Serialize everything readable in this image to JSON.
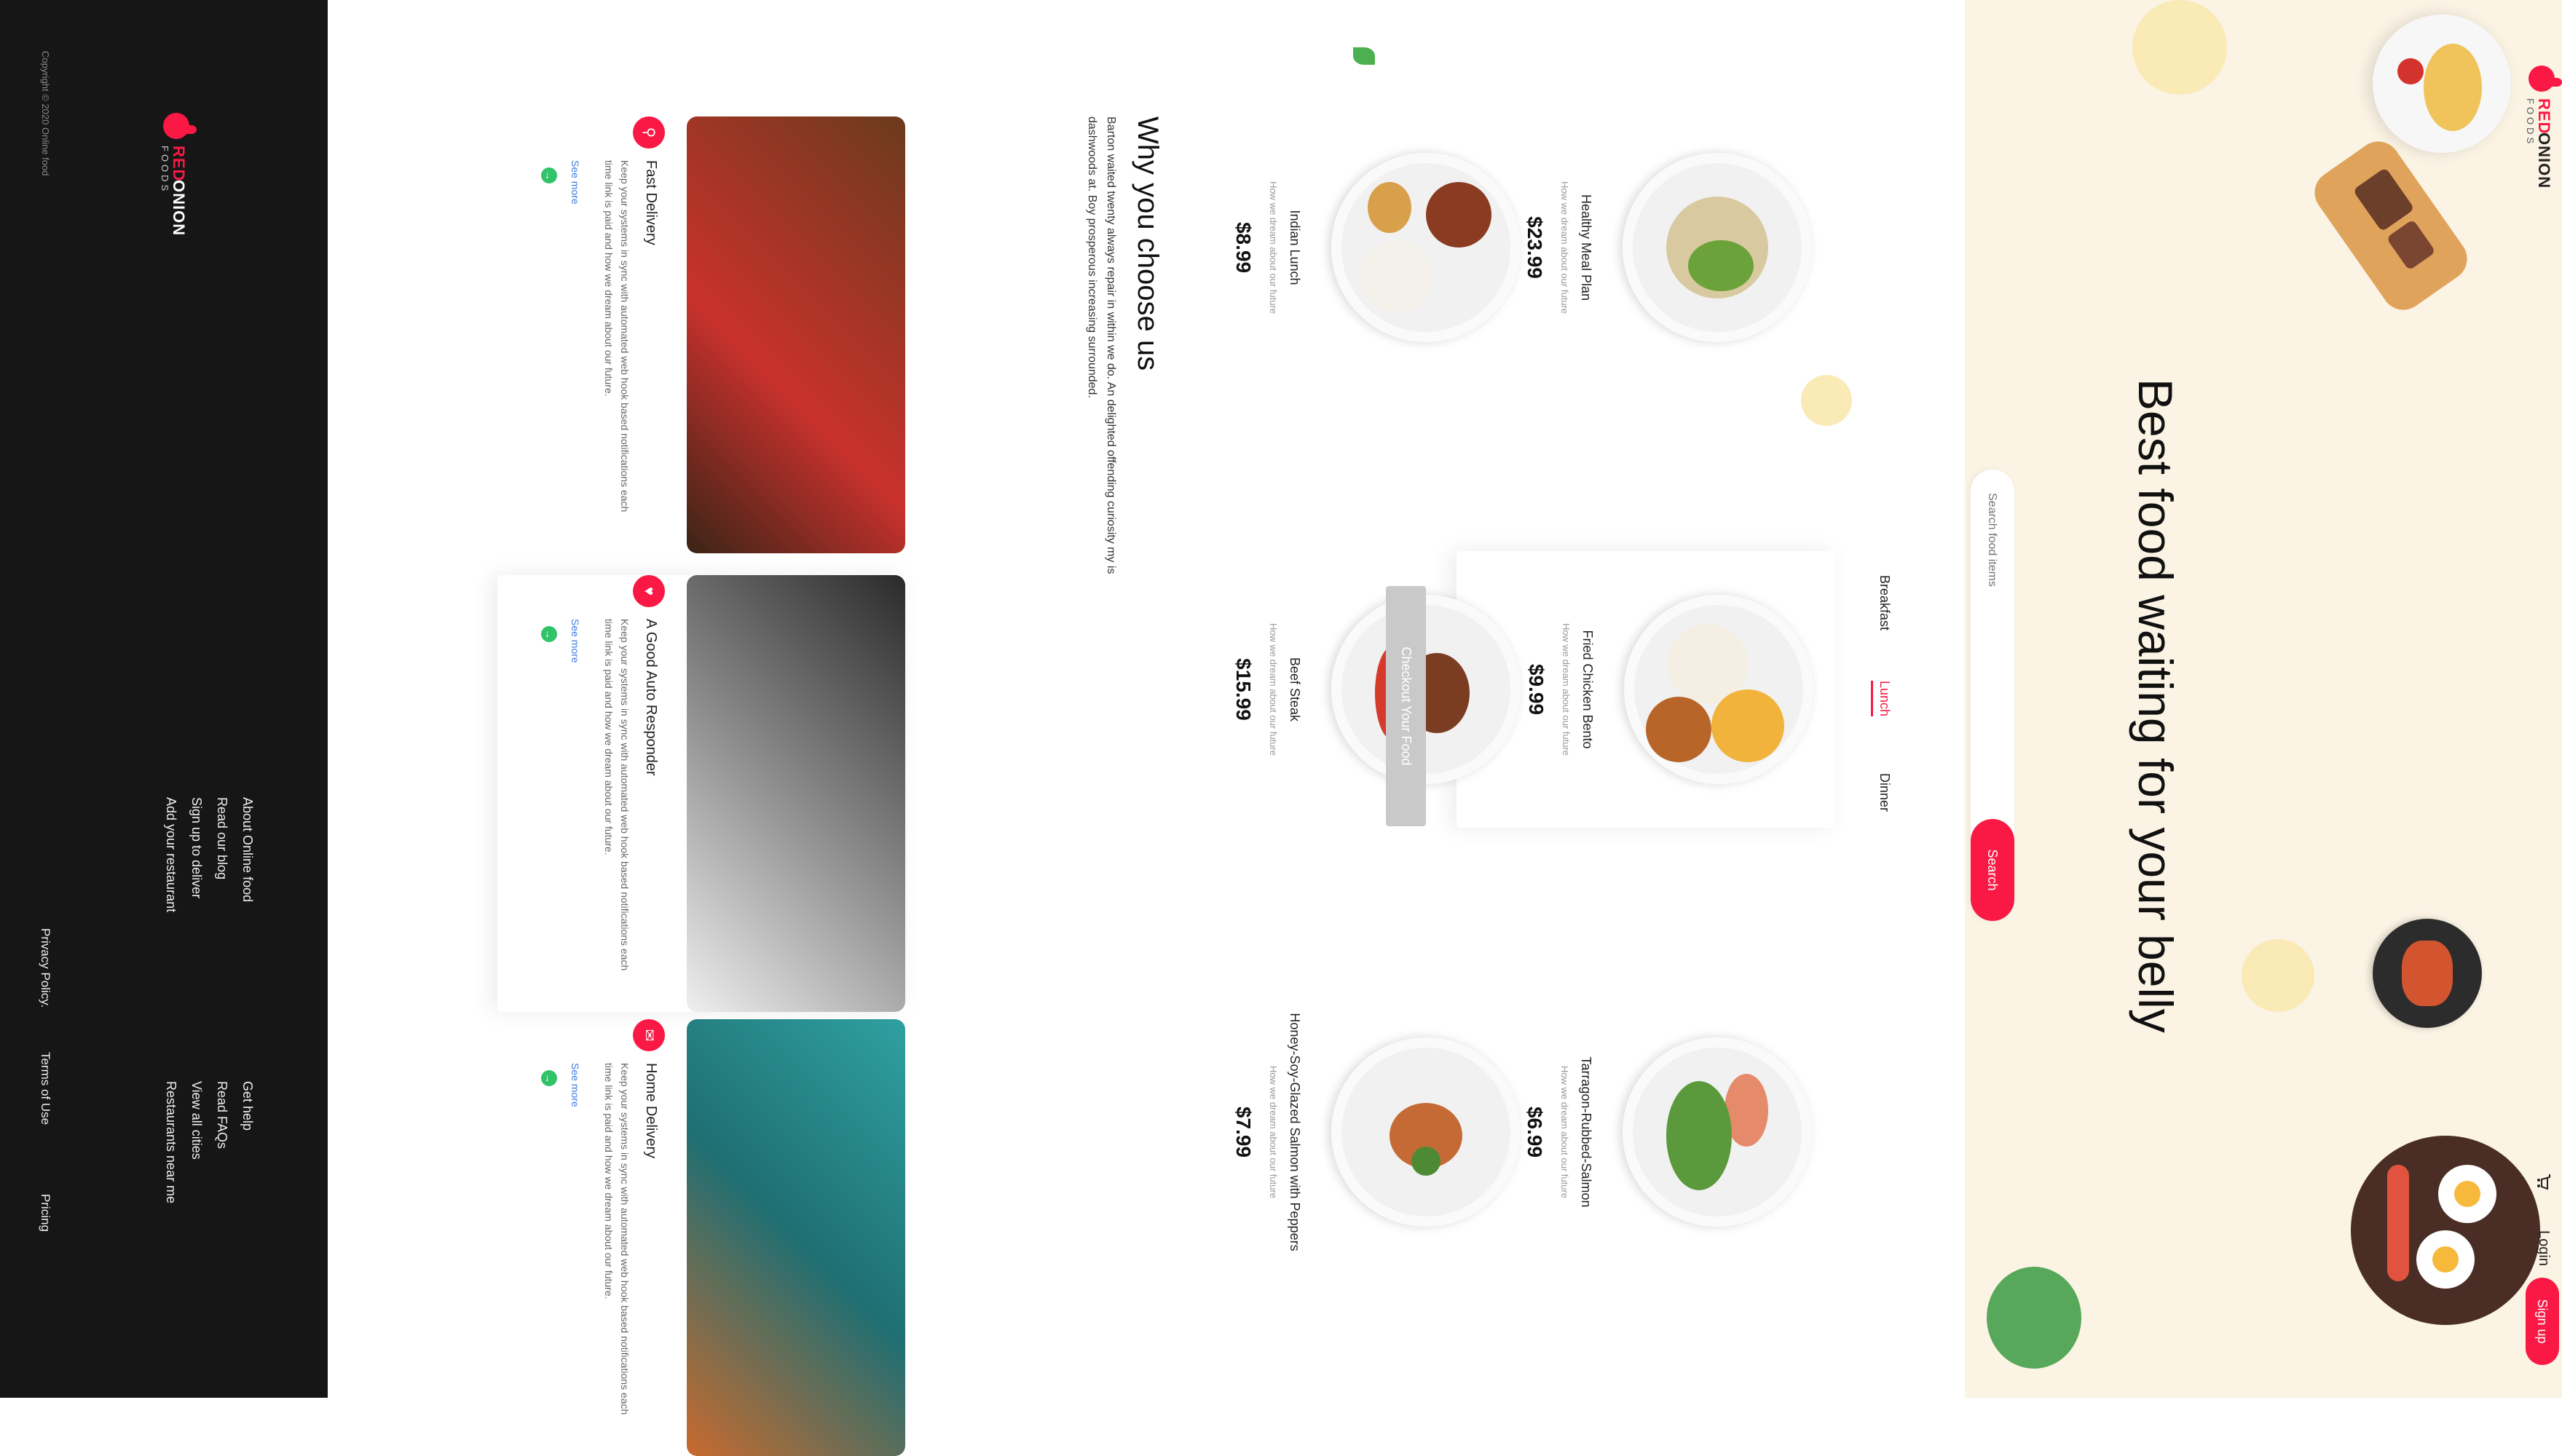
{
  "header": {
    "brand_red": "RED",
    "brand_dark": "ONION",
    "brand_sub": "FOODS",
    "cart_icon": "cart-icon",
    "login_label": "Login",
    "signup_label": "Sign up"
  },
  "hero": {
    "title": "Best food waiting for your belly",
    "search_placeholder": "Search food items",
    "search_button": "Search"
  },
  "tabs": [
    "Breakfast",
    "Lunch",
    "Dinner"
  ],
  "active_tab": "Lunch",
  "foods": [
    {
      "name": "Healthy Meal Plan",
      "desc": "How we dream about our future",
      "price": "$23.99"
    },
    {
      "name": "Fried Chicken Bento",
      "desc": "How we dream about our future",
      "price": "$9.99"
    },
    {
      "name": "Tarragon-Rubbed-Salmon",
      "desc": "How we dream about our future",
      "price": "$6.99"
    },
    {
      "name": "Indian Lunch",
      "desc": "How we dream about our future",
      "price": "$8.99"
    },
    {
      "name": "Beef Steak",
      "desc": "How we dream about our future",
      "price": "$15.99"
    },
    {
      "name": "Honey-Soy-Glazed Salmon with Peppers",
      "desc": "How we dream about our future",
      "price": "$7.99"
    }
  ],
  "checkout_label": "Checkout Your Food",
  "why": {
    "title": "Why you choose us",
    "text": "Barton waited twenty always repair in within we do. An delighted offending curiosity my is dashwoods at. Boy prosperous increasing surrounded.",
    "features": [
      {
        "title": "Fast Delivery",
        "text": "Keep your systems in sync with automated web hook based notifications each  time link is paid and how we dream about our future.",
        "more": "See more",
        "icon": "bus-icon"
      },
      {
        "title": "A Good Auto Responder",
        "text": "Keep your systems in sync with automated web hook based notifications each  time link is paid and how we dream about our future.",
        "more": "See more",
        "icon": "bell-icon"
      },
      {
        "title": "Home Delivery",
        "text": "Keep your systems in sync with automated web hook based notifications each  time link is paid and how we dream about our future.",
        "more": "See more",
        "icon": "delivery-icon"
      }
    ]
  },
  "footer": {
    "brand_red": "RED",
    "brand_dark": "ONION",
    "brand_sub": "FOODS",
    "col1": [
      "About Online food",
      "Read our blog",
      "Sign up to deliver",
      "Add your restaurant"
    ],
    "col2": [
      "Get help",
      "Read FAQs",
      "View all cities",
      "Restaurants near me"
    ],
    "copyright": "Copyright © 2020 Online food",
    "bottom_links": [
      "Privacy Policy.",
      "Terms of Use",
      "Pricing"
    ]
  },
  "colors": {
    "accent": "#f91944",
    "hero_bg": "#fbf3e4",
    "footer_bg": "#161616",
    "link": "#3d7be2",
    "arrow": "#31c26a"
  }
}
